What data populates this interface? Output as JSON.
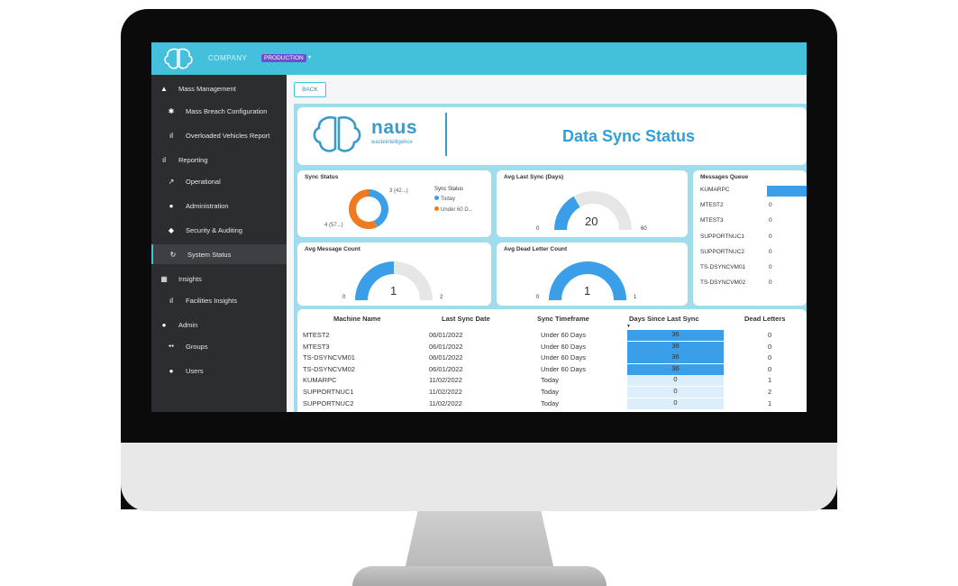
{
  "app": {
    "company": "COMPANY",
    "environment": "PRODUCTION",
    "env_caret": "▾"
  },
  "colors": {
    "topbar": "#45c0dc",
    "sidebar": "#2c2d30",
    "accent": "#2fa0d8",
    "donut_today": "#3a9ee8",
    "donut_under60": "#f07a1f",
    "days_high": "#3a9ee8",
    "days_low": "#ddeefb"
  },
  "sidebar": {
    "items": [
      {
        "label": "Mass Management",
        "icon": "bell-icon",
        "glyph": "▲",
        "level": 1
      },
      {
        "label": "Mass Breach Configuration",
        "icon": "gear-icon",
        "glyph": "✱",
        "level": 2
      },
      {
        "label": "Overloaded Vehicles Report",
        "icon": "bar-chart-icon",
        "glyph": "ıl",
        "level": 2
      },
      {
        "label": "Reporting",
        "icon": "bar-chart-icon",
        "glyph": "ıl",
        "level": 1
      },
      {
        "label": "Operational",
        "icon": "trend-line-icon",
        "glyph": "↗",
        "level": 2
      },
      {
        "label": "Administration",
        "icon": "user-gear-icon",
        "glyph": "●",
        "level": 2
      },
      {
        "label": "Security & Auditing",
        "icon": "shield-icon",
        "glyph": "◆",
        "level": 2
      },
      {
        "label": "System Status",
        "icon": "sync-icon",
        "glyph": "↻",
        "level": 2,
        "active": true
      },
      {
        "label": "Insights",
        "icon": "dashboard-icon",
        "glyph": "▦",
        "level": 1
      },
      {
        "label": "Facilities Insights",
        "icon": "bar-chart-icon",
        "glyph": "ıl",
        "level": 2
      },
      {
        "label": "Admin",
        "icon": "user-icon",
        "glyph": "●",
        "level": 1
      },
      {
        "label": "Groups",
        "icon": "users-icon",
        "glyph": "●●",
        "level": 2
      },
      {
        "label": "Users",
        "icon": "user-icon",
        "glyph": "●",
        "level": 2
      }
    ]
  },
  "toolbar": {
    "back_label": "BACK"
  },
  "report": {
    "brand_name": "naus",
    "brand_tagline": "wasteintelligence",
    "title": "Data Sync Status"
  },
  "sync_status": {
    "title": "Sync Status",
    "legend_title": "Sync Status",
    "legend": [
      {
        "label": "Today",
        "color": "#3a9ee8"
      },
      {
        "label": "Under 60 D...",
        "color": "#f07a1f"
      }
    ],
    "slices": [
      {
        "label": "Today",
        "value": 3,
        "display": "3 (42...)"
      },
      {
        "label": "Under 60 Days",
        "value": 4,
        "display": "4 (57...)"
      }
    ]
  },
  "gauges": {
    "avg_last_sync": {
      "title": "Avg Last Sync (Days)",
      "value": 20,
      "min": 0,
      "max": 60
    },
    "avg_message_count": {
      "title": "Avg Message Count",
      "value": 1,
      "min": 0,
      "max": 2
    },
    "avg_dead_letter": {
      "title": "Avg Dead Letter Count",
      "value": 1,
      "min": 0,
      "max": 1
    }
  },
  "messages_queue": {
    "title": "Messages Queue",
    "rows": [
      {
        "name": "KUMARPC",
        "value": "",
        "bar": true
      },
      {
        "name": "MTEST2",
        "value": "0"
      },
      {
        "name": "MTEST3",
        "value": "0"
      },
      {
        "name": "SUPPORTNUC1",
        "value": "0"
      },
      {
        "name": "SUPPORTNUC2",
        "value": "0"
      },
      {
        "name": "TS-DSYNCVM01",
        "value": "0"
      },
      {
        "name": "TS-DSYNCVM02",
        "value": "0"
      }
    ]
  },
  "sync_table": {
    "headers": {
      "machine": "Machine Name",
      "last_sync": "Last Sync Date",
      "timeframe": "Sync Timeframe",
      "days": "Days Since Last Sync",
      "dead": "Dead Letters"
    },
    "sort_caret": "▼",
    "rows": [
      {
        "machine": "MTEST2",
        "last_sync": "06/01/2022",
        "timeframe": "Under 60 Days",
        "days": "36",
        "dead": "0",
        "high": true
      },
      {
        "machine": "MTEST3",
        "last_sync": "06/01/2022",
        "timeframe": "Under 60 Days",
        "days": "36",
        "dead": "0",
        "high": true
      },
      {
        "machine": "TS-DSYNCVM01",
        "last_sync": "06/01/2022",
        "timeframe": "Under 60 Days",
        "days": "36",
        "dead": "0",
        "high": true
      },
      {
        "machine": "TS-DSYNCVM02",
        "last_sync": "06/01/2022",
        "timeframe": "Under 60 Days",
        "days": "36",
        "dead": "0",
        "high": true
      },
      {
        "machine": "KUMARPC",
        "last_sync": "11/02/2022",
        "timeframe": "Today",
        "days": "0",
        "dead": "1",
        "high": false
      },
      {
        "machine": "SUPPORTNUC1",
        "last_sync": "11/02/2022",
        "timeframe": "Today",
        "days": "0",
        "dead": "2",
        "high": false
      },
      {
        "machine": "SUPPORTNUC2",
        "last_sync": "11/02/2022",
        "timeframe": "Today",
        "days": "0",
        "dead": "1",
        "high": false
      }
    ]
  }
}
